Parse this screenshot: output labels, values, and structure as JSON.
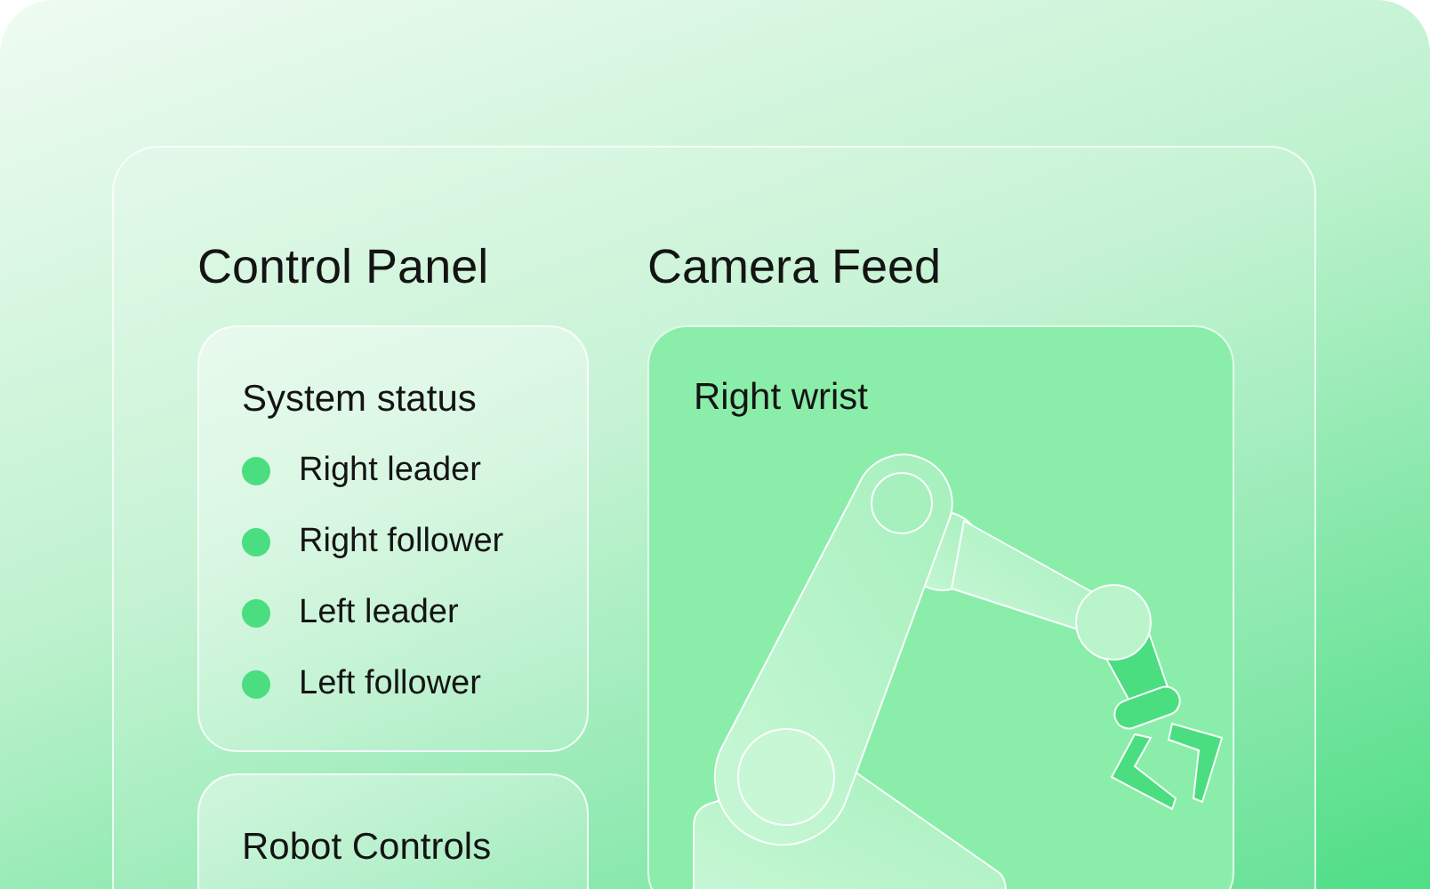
{
  "control_panel": {
    "title": "Control Panel",
    "status_card": {
      "title": "System status",
      "items": [
        {
          "label": "Right leader"
        },
        {
          "label": "Right follower"
        },
        {
          "label": "Left leader"
        },
        {
          "label": "Left follower"
        }
      ]
    },
    "controls_card": {
      "title": "Robot Controls"
    }
  },
  "camera_feed": {
    "title": "Camera Feed",
    "view": {
      "label": "Right wrist"
    }
  }
}
